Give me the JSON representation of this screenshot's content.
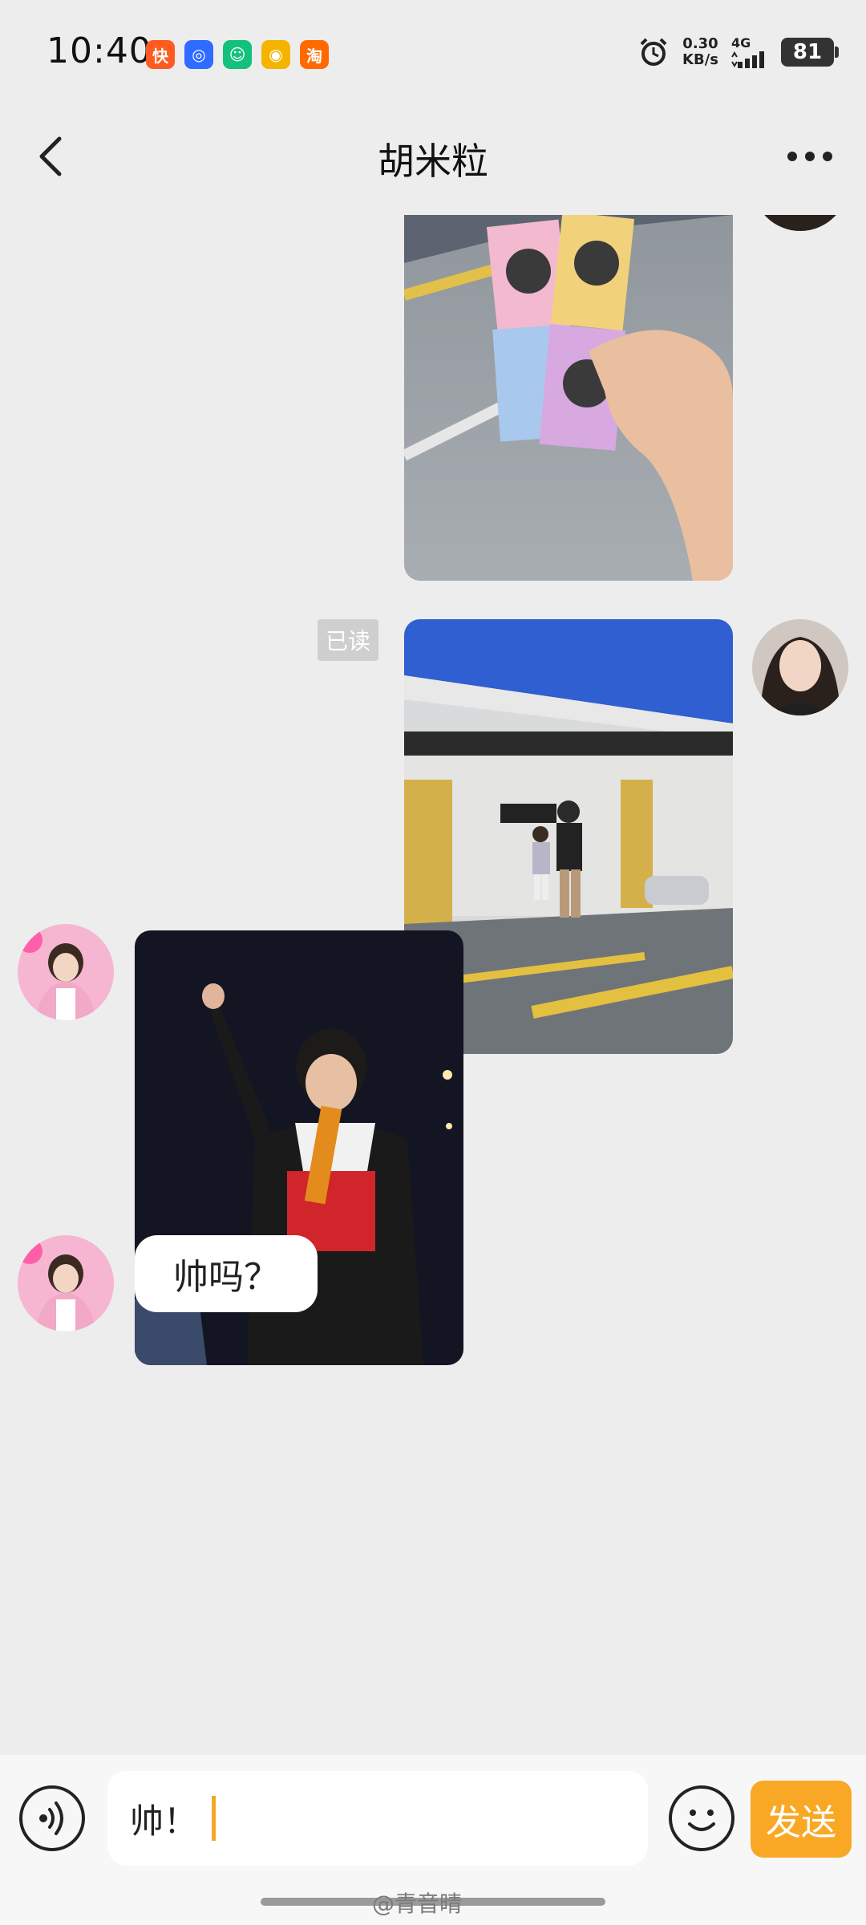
{
  "status_bar": {
    "time": "10:40",
    "app_icons": [
      {
        "name": "app-kuaishou-icon",
        "glyph": "快",
        "color": "#ff5a1f"
      },
      {
        "name": "app-tool-icon",
        "glyph": "◎",
        "color": "#2f6bff"
      },
      {
        "name": "app-mi-icon",
        "glyph": "☺",
        "color": "#12c27c"
      },
      {
        "name": "app-weibo-icon",
        "glyph": "◉",
        "color": "#f5b400"
      },
      {
        "name": "app-taobao-icon",
        "glyph": "淘",
        "color": "#ff6a00"
      }
    ],
    "net_speed_value": "0.30",
    "net_speed_unit": "KB/s",
    "network": "4G",
    "battery": "81"
  },
  "header": {
    "title": "胡米粒",
    "back_icon": "chevron-left-icon",
    "more_icon": "more-dots-icon"
  },
  "messages": [
    {
      "side": "right",
      "type": "image",
      "subject": "hand holding photo-booth sticker strips in parking garage"
    },
    {
      "side": "right",
      "type": "image",
      "subject": "man and child walking in underground parking garage",
      "read_label": "已读"
    },
    {
      "side": "left",
      "type": "image",
      "subject": "singer on concert stage pointing upward"
    },
    {
      "side": "left",
      "type": "text",
      "text": "帅吗？"
    }
  ],
  "input_bar": {
    "value": "帅！",
    "send_label": "发送"
  },
  "watermark": "@青音晴",
  "colors": {
    "accent": "#f9a825",
    "background": "#ededed"
  }
}
